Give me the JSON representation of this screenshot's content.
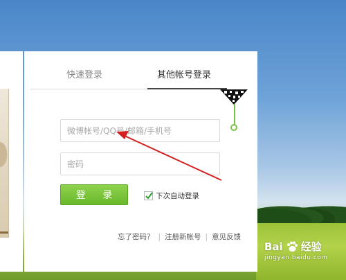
{
  "login": {
    "tabs": [
      {
        "label": "快速登录"
      },
      {
        "label": "其他帐号登录"
      }
    ],
    "account_placeholder": "微博帐号/QQ号/邮箱/手机号",
    "password_placeholder": "密码",
    "login_button": "登 录",
    "auto_login_label": "下次自动登录",
    "auto_login_checked": true,
    "links": {
      "forgot": "忘了密码？",
      "sep1": "|",
      "register": "注册新帐号",
      "sep2": "|",
      "feedback": "意见反馈"
    }
  },
  "watermark": {
    "brand": "Bai",
    "brand_suffix": "经验",
    "url": "jingyan.baidu.com"
  },
  "colors": {
    "accent_green": "#7ac143",
    "button_green": "#69b82c",
    "arrow_red": "#d32020"
  },
  "icons": {
    "qr": "qr-code-icon",
    "check": "checkmark-icon",
    "paw": "baidu-paw-icon"
  }
}
